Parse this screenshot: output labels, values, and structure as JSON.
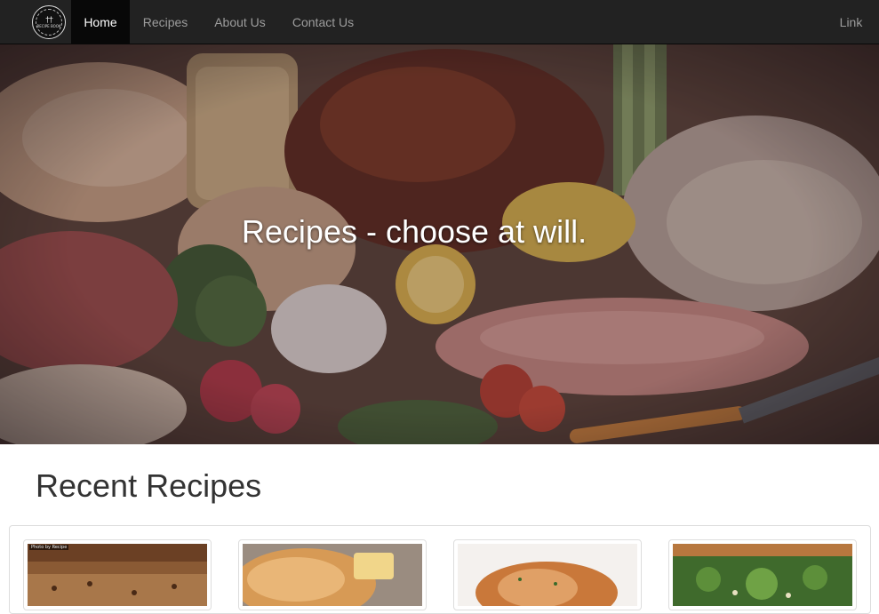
{
  "nav": {
    "brand_text": "RECIPE BOOK",
    "items": [
      {
        "label": "Home",
        "active": true
      },
      {
        "label": "Recipes",
        "active": false
      },
      {
        "label": "About Us",
        "active": false
      },
      {
        "label": "Contact Us",
        "active": false
      }
    ],
    "right_link": "Link"
  },
  "hero": {
    "title": "Recipes - choose at will."
  },
  "recent": {
    "title": "Recent Recipes",
    "thumbnails": [
      {
        "subject": "banana-bread",
        "credit": "Photo by Recipe"
      },
      {
        "subject": "crescent-rolls"
      },
      {
        "subject": "grilled-chicken"
      },
      {
        "subject": "salad-toast"
      }
    ]
  },
  "colors": {
    "navbar_bg": "#222222",
    "nav_active_bg": "#080808",
    "nav_text": "#9d9d9d",
    "heading_text": "#333333"
  }
}
